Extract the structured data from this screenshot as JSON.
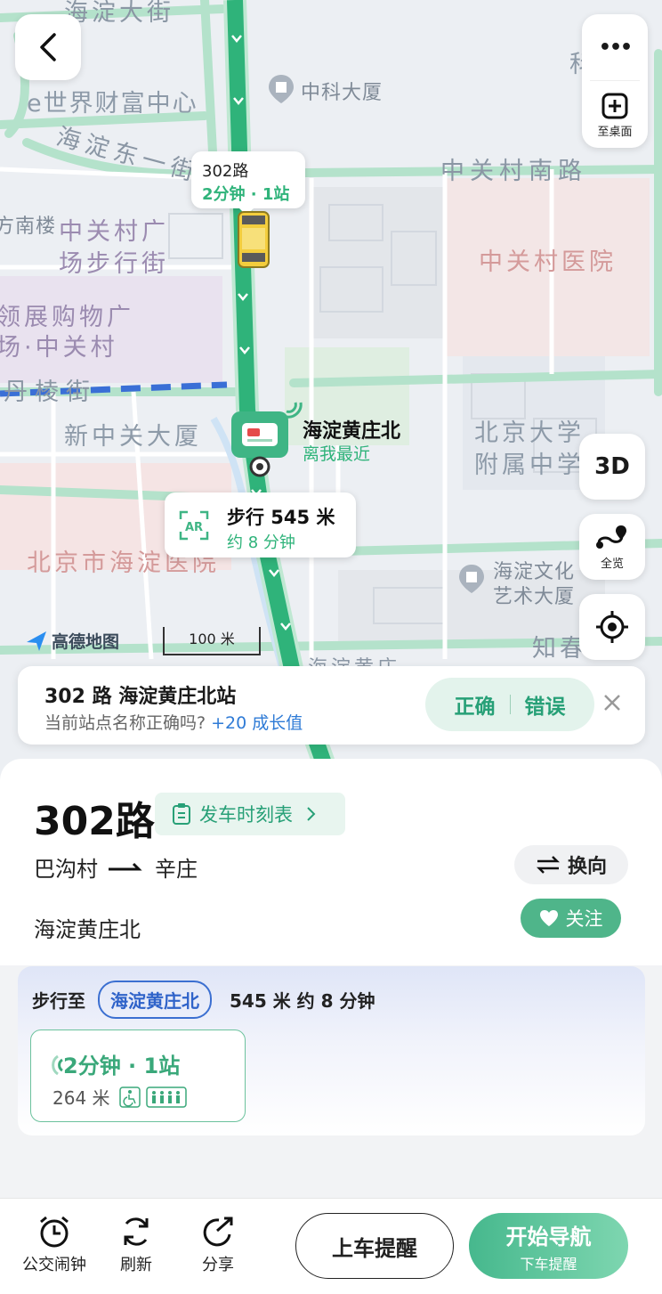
{
  "map": {
    "labels": {
      "haidian_dajie": "海淀大街",
      "e_world": "e世界财富中心",
      "zhongke_dasha": "中科大厦",
      "ke_fragment": "科",
      "haidian_dongyijie": "海淀东一街",
      "zhongguancun_nanlu": "中关村南路",
      "nanlou": "方南楼",
      "zgc_plaza_1": "中关村广",
      "zgc_plaza_2": "场步行街",
      "zgc_hospital": "中关村医院",
      "lingzhan_1": "领展购物广",
      "lingzhan_2": "场·中关村",
      "danlingjie": "丹棱街",
      "xinzhongguancun": "新中关大厦",
      "pku_school_1": "北京大学",
      "pku_school_2": "附属中学",
      "haidian_hospital": "北京市海淀医院",
      "culture_1": "海淀文化",
      "culture_2": "艺术大厦",
      "zhichun": "知春",
      "haidian_huang": "海淀黄庄"
    },
    "bus_bubble": {
      "route": "302路",
      "eta": "2分钟 · 1站"
    },
    "station_bubble": {
      "name": "海淀黄庄北",
      "note": "离我最近"
    },
    "walk_bubble": {
      "ar": "AR",
      "distance": "步行 545 米",
      "time": "约 8 分钟"
    },
    "brand": "高德地图",
    "scale": "100 米",
    "buttons": {
      "more": "•••",
      "desktop": "至桌面",
      "threed": "3D",
      "overview": "全览"
    },
    "colors": {
      "route": "#2fb37a",
      "route_casing": "#bfe8d2",
      "road_green": "#a9dcc3",
      "subway": "#3a6fd6"
    }
  },
  "feedback": {
    "title": "302 路 海淀黄庄北站",
    "question": "当前站点名称正确吗?",
    "reward": "+20 成长值",
    "correct": "正确",
    "wrong": "错误"
  },
  "sheet": {
    "route_name": "302路",
    "timetable": "发车时刻表",
    "from": "巴沟村",
    "to": "辛庄",
    "switch": "换向",
    "station": "海淀黄庄北",
    "follow": "关注",
    "walk_to": "步行至",
    "walk_stop": "海淀黄庄北",
    "walk_info": "545 米 约 8 分钟",
    "arrival": "2分钟 · 1站",
    "arrival_distance": "264 米"
  },
  "toolbar": {
    "alarm": "公交闹钟",
    "refresh": "刷新",
    "share": "分享",
    "board_remind": "上车提醒",
    "start_nav": "开始导航",
    "alight_remind": "下车提醒"
  }
}
